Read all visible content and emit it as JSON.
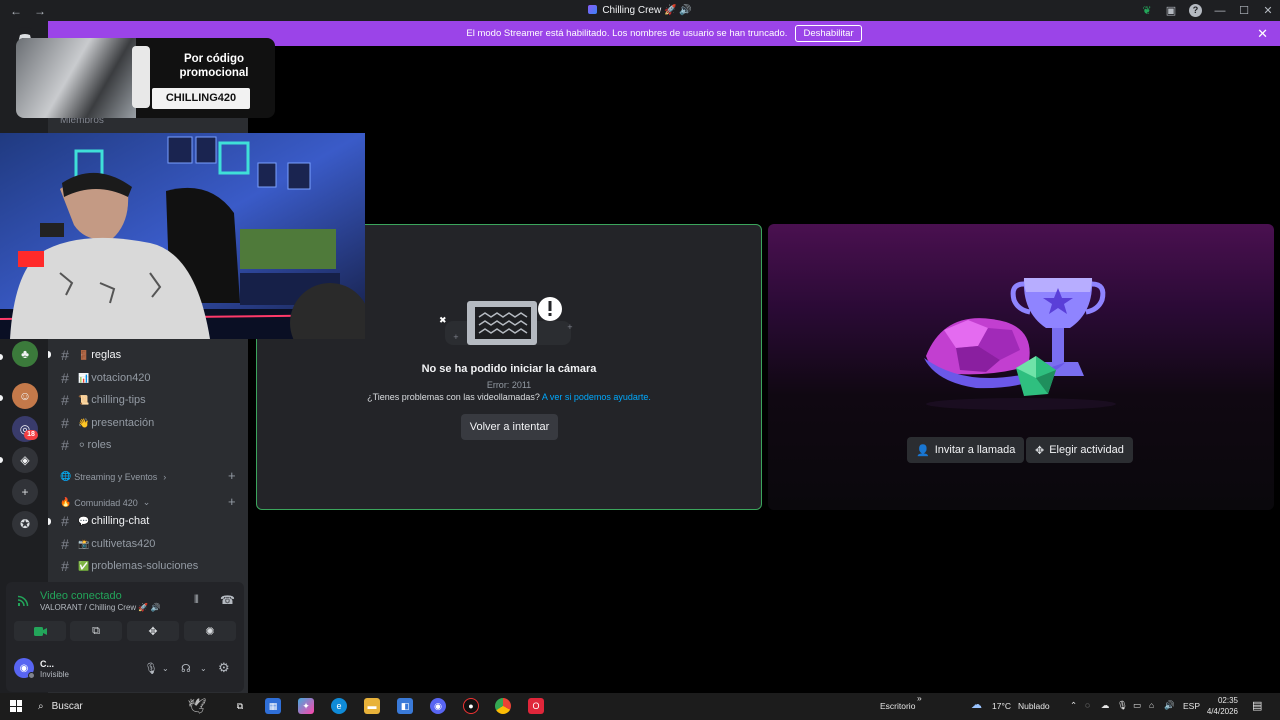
{
  "titlebar": {
    "back": "←",
    "forward": "→",
    "title": "Chilling Crew 🚀 🔊"
  },
  "banner": {
    "message": "El modo Streamer está habilitado. Los nombres de usuario se han truncado.",
    "disable_label": "Deshabilitar"
  },
  "rail": {
    "badges": [
      "18"
    ]
  },
  "sidebar": {
    "members_ghost": "Miembros",
    "channels_top": [
      {
        "emoji": "🚪",
        "name": "reglas",
        "unread": true
      },
      {
        "emoji": "📊",
        "name": "votacion420",
        "unread": false
      },
      {
        "emoji": "📜",
        "name": "chilling-tips",
        "unread": false
      },
      {
        "emoji": "👋",
        "name": "presentación",
        "unread": false
      },
      {
        "emoji": "⚪",
        "name": "roles",
        "unread": false
      }
    ],
    "categories": [
      {
        "emoji": "🌐",
        "name": "Streaming y Eventos",
        "chevron": "›"
      },
      {
        "emoji": "🔥",
        "name": "Comunidad 420",
        "chevron": "⌄"
      }
    ],
    "channels_bottom": [
      {
        "emoji": "💬",
        "name": "chilling-chat",
        "unread": true
      },
      {
        "emoji": "📸",
        "name": "cultivetas420",
        "unread": false
      },
      {
        "emoji": "✅",
        "name": "problemas-soluciones",
        "unread": false
      }
    ]
  },
  "voice": {
    "status": "Video conectado",
    "location": "VALORANT / Chilling Crew 🚀 🔊"
  },
  "user": {
    "name": "C...",
    "status": "Invisible"
  },
  "camera_tile": {
    "title": "No se ha podido iniciar la cámara",
    "error": "Error: 2011",
    "help_text": "¿Tienes problemas con las videollamadas?",
    "help_link": "A ver si podemos ayudarte.",
    "retry": "Volver a intentar"
  },
  "activity_tile": {
    "invite": "Invitar a llamada",
    "activity": "Elegir actividad"
  },
  "promo": {
    "title": "Por código promocional",
    "code": "CHILLING420"
  },
  "taskbar": {
    "search": "Buscar",
    "desktop": "Escritorio",
    "weather_temp": "17°C",
    "weather_desc": "Nublado",
    "lang": "ESP",
    "time": "02:35",
    "date": "4/4/2026"
  },
  "colors": {
    "accent": "#9b44e8",
    "connected": "#23a55a",
    "link": "#00a8fc",
    "tile_border": "#3ba55c"
  }
}
